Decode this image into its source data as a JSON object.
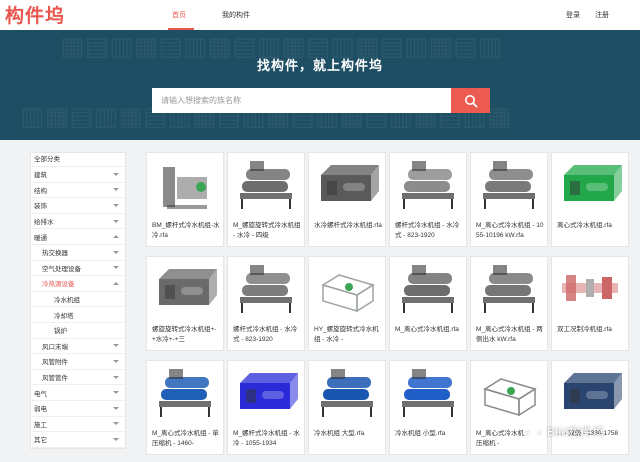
{
  "nav": {
    "logo": "构件坞",
    "home": "首页",
    "my_components": "我的构件",
    "login": "登录",
    "register": "注册"
  },
  "hero": {
    "title": "找构件，就上构件坞",
    "search_placeholder": "请输入想搜索的族名称",
    "background_color": "#1e4e63",
    "button_color": "#ec5b52"
  },
  "sidebar": {
    "header": "全部分类",
    "items": [
      {
        "label": "建筑",
        "level": 0,
        "caret": "down"
      },
      {
        "label": "结构",
        "level": 0,
        "caret": "down"
      },
      {
        "label": "装饰",
        "level": 0,
        "caret": "down"
      },
      {
        "label": "给排水",
        "level": 0,
        "caret": "down"
      },
      {
        "label": "暖通",
        "level": 0,
        "caret": "up"
      },
      {
        "label": "热交换器",
        "level": 1,
        "caret": "down"
      },
      {
        "label": "空气处理设备",
        "level": 1,
        "caret": "down"
      },
      {
        "label": "冷热源设备",
        "level": 1,
        "caret": "up",
        "active": true
      },
      {
        "label": "冷水机组",
        "level": 2,
        "caret": ""
      },
      {
        "label": "冷却塔",
        "level": 2,
        "caret": ""
      },
      {
        "label": "锅炉",
        "level": 2,
        "caret": ""
      },
      {
        "label": "风口末端",
        "level": 1,
        "caret": "down"
      },
      {
        "label": "风管附件",
        "level": 1,
        "caret": "down"
      },
      {
        "label": "风管管件",
        "level": 1,
        "caret": "down"
      },
      {
        "label": "电气",
        "level": 0,
        "caret": "down"
      },
      {
        "label": "弱电",
        "level": 0,
        "caret": "down"
      },
      {
        "label": "施工",
        "level": 0,
        "caret": "down"
      },
      {
        "label": "其它",
        "level": 0,
        "caret": "down"
      }
    ]
  },
  "cards": [
    {
      "title": "BM_螺杆式冷水机组-水冷.rfa",
      "color": "#8a8a8a",
      "shape": "open"
    },
    {
      "title": "M_螺旋旋转式冷水机组 - 水冷 - 四级",
      "color": "#6e6e6e",
      "shape": "twin"
    },
    {
      "title": "水冷螺杆式冷水机组.rfa",
      "color": "#5a5a5a",
      "shape": "block"
    },
    {
      "title": "螺杆式冷水机组 - 水冷式 - 823-1920",
      "color": "#8c8c8c",
      "shape": "twin"
    },
    {
      "title": "M_离心式冷水机组 - 1055-10196 kW.rfa",
      "color": "#7a7a7a",
      "shape": "twin"
    },
    {
      "title": "离心式冷水机组.rfa",
      "color": "#22a84a",
      "shape": "block"
    },
    {
      "title": "螺旋旋转式冷水机组+-+水冷+-+三",
      "color": "#6a6a6a",
      "shape": "block"
    },
    {
      "title": "螺杆式冷水机组 - 水冷式 - 823-1920",
      "color": "#7d7d7d",
      "shape": "twin"
    },
    {
      "title": "HY_螺旋旋转式冷水机组 - 水冷 -",
      "color": "#9fa6a0",
      "shape": "outline"
    },
    {
      "title": "M_离心式冷水机组.rfa",
      "color": "#6d6d6d",
      "shape": "twin"
    },
    {
      "title": "M_离心式冷水机组 - 两侧出水 kW.rfa",
      "color": "#767676",
      "shape": "twin"
    },
    {
      "title": "双工况制冷机组.rfa",
      "color": "#cc6666",
      "shape": "pipe"
    },
    {
      "title": "M_离心式冷水机组 - 单压缩机 - 1460-",
      "color": "#1f5fb5",
      "shape": "twin"
    },
    {
      "title": "M_螺杆式冷水机组 - 水冷 - 1055-1934",
      "color": "#2a2ad8",
      "shape": "block"
    },
    {
      "title": "冷水机组 大型.rfa",
      "color": "#1a55b0",
      "shape": "twin"
    },
    {
      "title": "冷水机组 小型.rfa",
      "color": "#1f5ec7",
      "shape": "twin"
    },
    {
      "title": "M_离心式冷水机组 - 单压缩机 -",
      "color": "#8a8a8a",
      "shape": "outline"
    },
    {
      "title": "... - 双级 - 1336-1758",
      "color": "#2a4570",
      "shape": "block"
    }
  ],
  "watermark": "BIM构件坞"
}
